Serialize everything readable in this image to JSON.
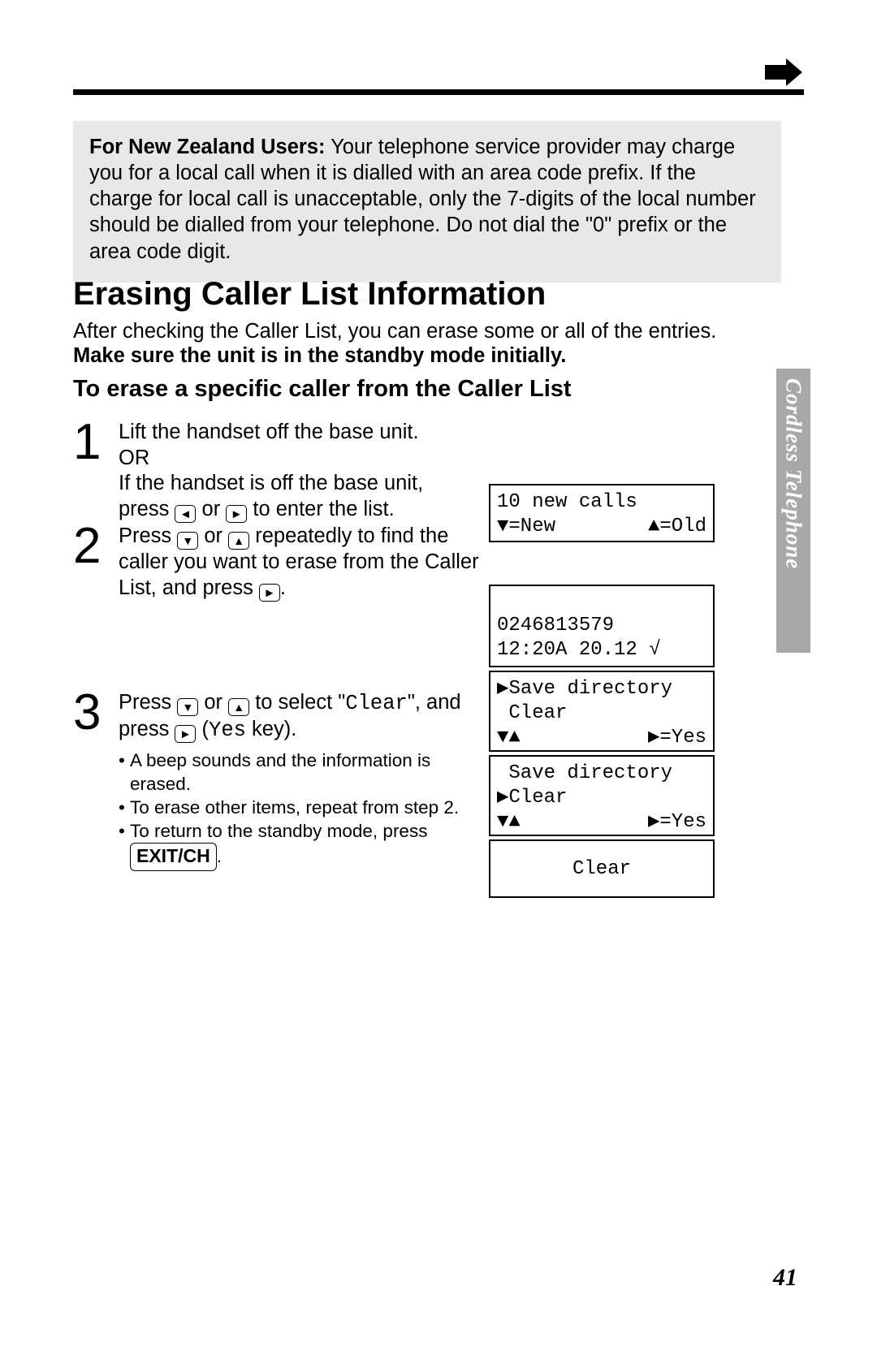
{
  "note": {
    "title": "For New Zealand Users:",
    "body": "Your telephone service provider may charge you for a local call when it is dialled with an area code prefix. If the charge for local call is unacceptable, only the 7-digits of the local number should be dialled from your telephone. Do not dial the \"0\" prefix or the area code digit."
  },
  "section_title": "Erasing Caller List Information",
  "intro_line": "After checking the Caller List, you can erase some or all of the entries.",
  "intro_bold": "Make sure the unit is in the standby mode initially.",
  "sub_heading": "To erase a specific caller from the Caller List",
  "steps": {
    "s1": {
      "num": "1",
      "line1": "Lift the handset off the base unit.",
      "or": "OR",
      "line2a": "If the handset is off the base unit,",
      "line2b_pre": "press ",
      "left_key": "◄",
      "or_word": " or ",
      "right_key": "►",
      "line2b_post": " to enter the list."
    },
    "s2": {
      "num": "2",
      "pre": "Press ",
      "down_key": "▼",
      "or_word": " or ",
      "up_key": "▲",
      "mid": " repeatedly to find the caller you want to erase from the Caller List, and press ",
      "right_key": "►",
      "end": "."
    },
    "s3": {
      "num": "3",
      "pre": "Press ",
      "down_key": "▼",
      "or_word": " or ",
      "up_key": "▲",
      "mid_a": " to select \"",
      "clear_mono": "Clear",
      "mid_b": "\", and press ",
      "right_key": "►",
      "mid_c": " (",
      "yes_mono": "Yes",
      "mid_d": " key).",
      "bullets": {
        "b1": "A beep sounds and the information is erased.",
        "b2": "To erase other items, repeat from step 2.",
        "b3_a": "To return to the standby mode, press ",
        "b3_exit": "EXIT/CH",
        "b3_b": "."
      }
    }
  },
  "lcd": {
    "d1": {
      "l1": "10 new calls",
      "l2_left": "▼=New",
      "l2_right": "▲=Old"
    },
    "d2": {
      "l1": "0246813579",
      "l2": "12:20A 20.12 √"
    },
    "d3": {
      "l1": "▶Save directory",
      "l2": " Clear",
      "l3_left": "▼▲",
      "l3_right": "▶=Yes"
    },
    "d4": {
      "l1": " Save directory",
      "l2": "▶Clear",
      "l3_left": "▼▲",
      "l3_right": "▶=Yes"
    },
    "d5": {
      "l1": "Clear"
    }
  },
  "side_tab": "Cordless Telephone",
  "page_number": "41"
}
